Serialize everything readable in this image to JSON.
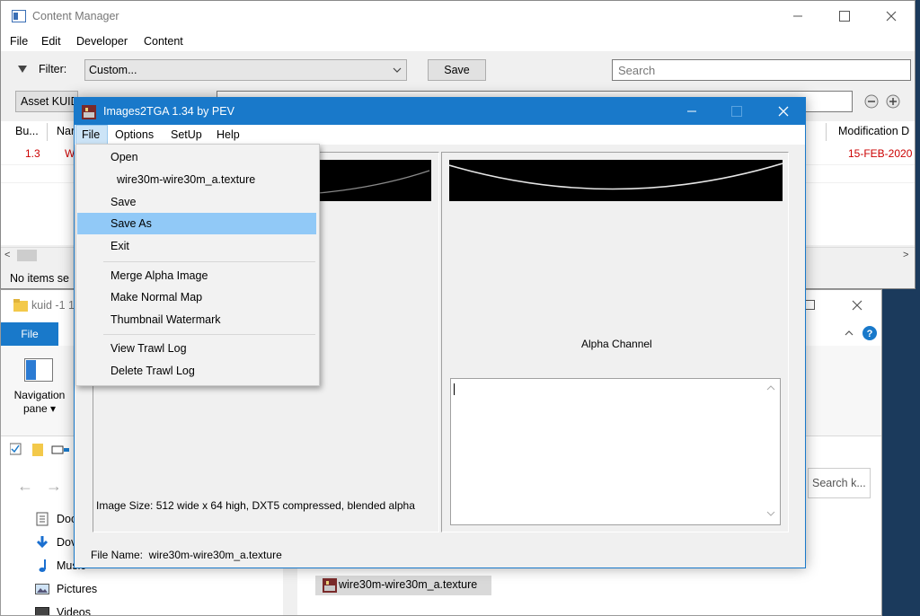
{
  "content_manager": {
    "title": "Content Manager",
    "menu": [
      "File",
      "Edit",
      "Developer",
      "Content"
    ],
    "filter_label": "Filter:",
    "filter_value": "Custom...",
    "save_label": "Save",
    "search_placeholder": "Search",
    "asset_kuid_label": "Asset KUID",
    "columns": [
      "Bu...",
      "Nar",
      "Modification D"
    ],
    "row": {
      "build": "1.3",
      "name": "W",
      "modified": "15-FEB-2020"
    },
    "status": "No items se"
  },
  "explorer": {
    "title": "kuid -1 1",
    "file_tab": "File",
    "nav_pane_label": "Navigation pane",
    "search_placeholder": "Search k...",
    "nav_items": [
      "Doc",
      "Dov",
      "Music",
      "Pictures",
      "Videos"
    ],
    "file_item": "wire30m-wire30m_a.texture"
  },
  "images2tga": {
    "title": "Images2TGA 1.34 by PEV",
    "menu": [
      "File",
      "Options",
      "SetUp",
      "Help"
    ],
    "alpha_label": "Alpha Channel",
    "image_size_text": "Image Size: 512 wide x 64 high, DXT5 compressed, blended alpha",
    "file_name_text": "File Name:  wire30m-wire30m_a.texture"
  },
  "file_menu": {
    "items": [
      "Open",
      "wire30m-wire30m_a.texture",
      "Save",
      "Save As",
      "Exit",
      "Merge Alpha Image",
      "Make Normal Map",
      "Thumbnail Watermark",
      "View Trawl Log",
      "Delete Trawl Log"
    ],
    "highlighted": "Save As"
  },
  "colors": {
    "accent": "#1979ca",
    "highlight": "#91c9f7",
    "red_text": "#cc0000"
  }
}
